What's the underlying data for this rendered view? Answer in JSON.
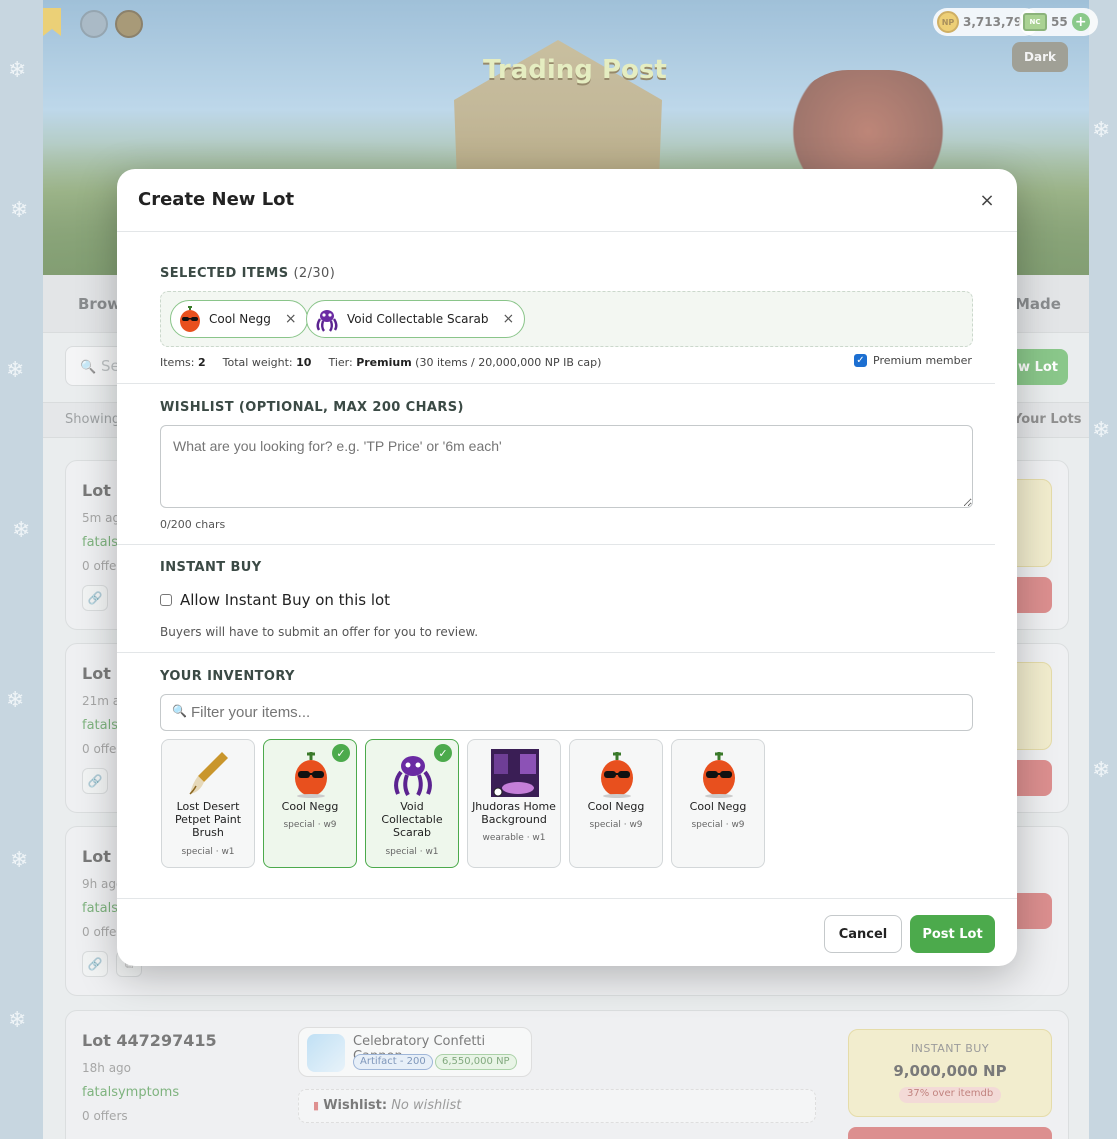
{
  "header": {
    "np_balance": "3,713,795",
    "nc_balance": "55",
    "np_coin_label": "NP",
    "nc_label": "NC",
    "dark_toggle": "Dark",
    "banner_title": "Trading Post"
  },
  "page": {
    "tabs": [
      {
        "label": "Brows"
      },
      {
        "label": "Made"
      }
    ],
    "search_placeholder": "Se",
    "new_lot_button": "w Lot",
    "showing_text": "Showing",
    "your_lots_link": "Your Lots",
    "lots": [
      {
        "id": "Lot 4",
        "time": "5m ago",
        "user": "fatalsy",
        "offers": "0 offer"
      },
      {
        "id": "Lot 4",
        "time": "21m ag",
        "user": "fatalsy",
        "offers": "0 offer"
      },
      {
        "id": "Lot 4",
        "time": "9h ago",
        "user": "fatalsy",
        "offers": "0 offer"
      },
      {
        "id": "Lot 447297415",
        "time": "18h ago",
        "user": "fatalsymptoms",
        "offers": "0 offers",
        "item_name": "Celebratory Confetti Cannon",
        "item_rarity": "Artifact - 200",
        "item_price": "6,550,000 NP",
        "wishlist_label": "Wishlist:",
        "wishlist_value": "No wishlist",
        "instant_buy_label": "INSTANT BUY",
        "instant_buy_price": "9,000,000 NP",
        "instant_buy_pct": "37% over itemdb"
      }
    ]
  },
  "modal": {
    "title": "Create New Lot",
    "close_label": "×",
    "selected": {
      "label": "SELECTED ITEMS",
      "count": "(2/30)",
      "items": [
        {
          "name": "Cool Negg",
          "remove": "×"
        },
        {
          "name": "Void Collectable Scarab",
          "remove": "×"
        }
      ],
      "items_label": "Items:",
      "items_value": "2",
      "weight_label": "Total weight:",
      "weight_value": "10",
      "tier_label": "Tier:",
      "tier_value": "Premium",
      "tier_detail": "(30 items / 20,000,000 NP IB cap)",
      "premium_label": "Premium member",
      "premium_checked": true
    },
    "wishlist": {
      "label": "WISHLIST (OPTIONAL, MAX 200 CHARS)",
      "placeholder": "What are you looking for? e.g. 'TP Price' or '6m each'",
      "value": "",
      "counter": "0/200 chars"
    },
    "instant_buy": {
      "label": "INSTANT BUY",
      "checkbox_label": "Allow Instant Buy on this lot",
      "checked": false,
      "help": "Buyers will have to submit an offer for you to review."
    },
    "inventory": {
      "label": "YOUR INVENTORY",
      "filter_placeholder": "Filter your items...",
      "items": [
        {
          "name": "Lost Desert Petpet Paint Brush",
          "sub": "special · w1",
          "icon": "paint-brush-icon",
          "selected": false
        },
        {
          "name": "Cool Negg",
          "sub": "special · w9",
          "icon": "cool-negg-icon",
          "selected": true
        },
        {
          "name": "Void Collectable Scarab",
          "sub": "special · w1",
          "icon": "void-scarab-icon",
          "selected": true
        },
        {
          "name": "Jhudoras Home Background",
          "sub": "wearable · w1",
          "icon": "background-icon",
          "selected": false
        },
        {
          "name": "Cool Negg",
          "sub": "special · w9",
          "icon": "cool-negg-icon",
          "selected": false
        },
        {
          "name": "Cool Negg",
          "sub": "special · w9",
          "icon": "cool-negg-icon",
          "selected": false
        }
      ]
    },
    "footer": {
      "cancel": "Cancel",
      "post": "Post Lot"
    }
  },
  "colors": {
    "accent_green": "#4caa4c",
    "brand_blue": "#1c6fd1",
    "danger_red": "#c95454"
  }
}
